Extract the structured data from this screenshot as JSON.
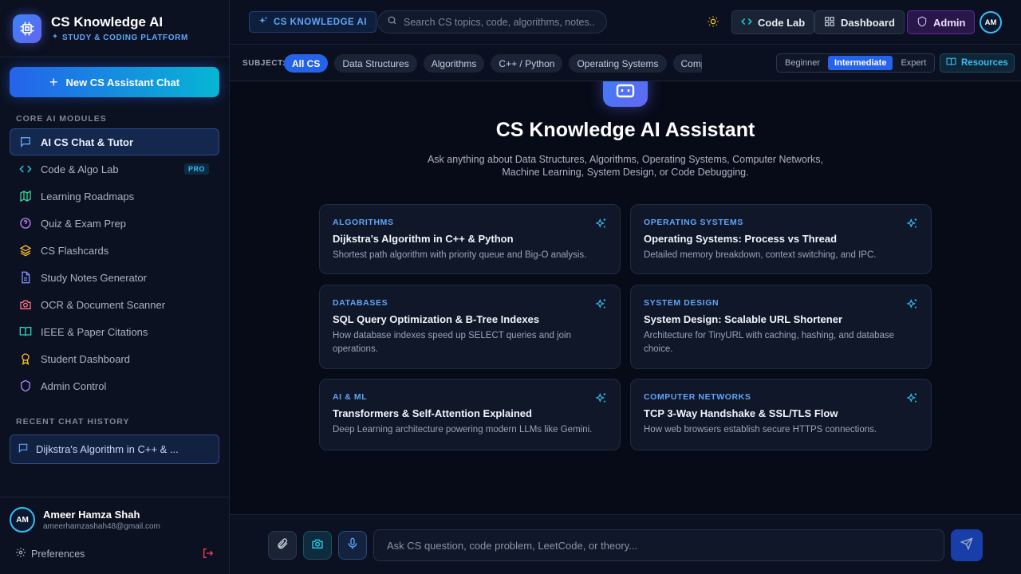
{
  "brand": {
    "title": "CS Knowledge AI",
    "subtitle": "STUDY & CODING PLATFORM"
  },
  "sidebar": {
    "new_chat": "New CS Assistant Chat",
    "section_core": "CORE AI MODULES",
    "items": [
      {
        "label": "AI CS Chat & Tutor",
        "icon": "chat-icon",
        "active": true
      },
      {
        "label": "Code & Algo Lab",
        "icon": "code-icon",
        "badge": "PRO"
      },
      {
        "label": "Learning Roadmaps",
        "icon": "map-icon"
      },
      {
        "label": "Quiz & Exam Prep",
        "icon": "help-circle-icon"
      },
      {
        "label": "CS Flashcards",
        "icon": "layers-icon"
      },
      {
        "label": "Study Notes Generator",
        "icon": "document-icon"
      },
      {
        "label": "OCR & Document Scanner",
        "icon": "camera-icon"
      },
      {
        "label": "IEEE & Paper Citations",
        "icon": "book-open-icon"
      },
      {
        "label": "Student Dashboard",
        "icon": "award-icon"
      },
      {
        "label": "Admin Control",
        "icon": "shield-icon"
      }
    ],
    "section_recent": "RECENT CHAT HISTORY",
    "recent": [
      "Dijkstra's Algorithm in C++ & ..."
    ],
    "user": {
      "initials": "AM",
      "name": "Ameer Hamza Shah",
      "email": "ameerhamzashah48@gmail.com"
    },
    "preferences": "Preferences"
  },
  "topbar": {
    "badge": "CS KNOWLEDGE AI",
    "search_placeholder": "Search CS topics, code, algorithms, notes...",
    "code_lab": "Code Lab",
    "dashboard": "Dashboard",
    "admin": "Admin",
    "avatar": "AM"
  },
  "subjects": {
    "label": "SUBJECT:",
    "chips": [
      "All CS",
      "Data Structures",
      "Algorithms",
      "C++ / Python",
      "Operating Systems",
      "Computer Networks"
    ],
    "active_chip": 0,
    "levels": [
      "Beginner",
      "Intermediate",
      "Expert"
    ],
    "active_level": 1,
    "resources": "Resources"
  },
  "hero": {
    "title": "CS Knowledge AI Assistant",
    "description": "Ask anything about Data Structures, Algorithms, Operating Systems, Computer Networks, Machine Learning, System Design, or Code Debugging."
  },
  "cards": [
    {
      "category": "ALGORITHMS",
      "title": "Dijkstra's Algorithm in C++ & Python",
      "desc": "Shortest path algorithm with priority queue and Big-O analysis."
    },
    {
      "category": "OPERATING SYSTEMS",
      "title": "Operating Systems: Process vs Thread",
      "desc": "Detailed memory breakdown, context switching, and IPC."
    },
    {
      "category": "DATABASES",
      "title": "SQL Query Optimization & B-Tree Indexes",
      "desc": "How database indexes speed up SELECT queries and join operations."
    },
    {
      "category": "SYSTEM DESIGN",
      "title": "System Design: Scalable URL Shortener",
      "desc": "Architecture for TinyURL with caching, hashing, and database choice."
    },
    {
      "category": "AI & ML",
      "title": "Transformers & Self-Attention Explained",
      "desc": "Deep Learning architecture powering modern LLMs like Gemini."
    },
    {
      "category": "COMPUTER NETWORKS",
      "title": "TCP 3-Way Handshake & SSL/TLS Flow",
      "desc": "How web browsers establish secure HTTPS connections."
    }
  ],
  "composer": {
    "placeholder": "Ask CS question, code problem, LeetCode, or theory..."
  },
  "colors": {
    "accent": "#2563eb",
    "cyan": "#06b6d4",
    "bg": "#070b18",
    "sidebar": "#0b1120"
  }
}
